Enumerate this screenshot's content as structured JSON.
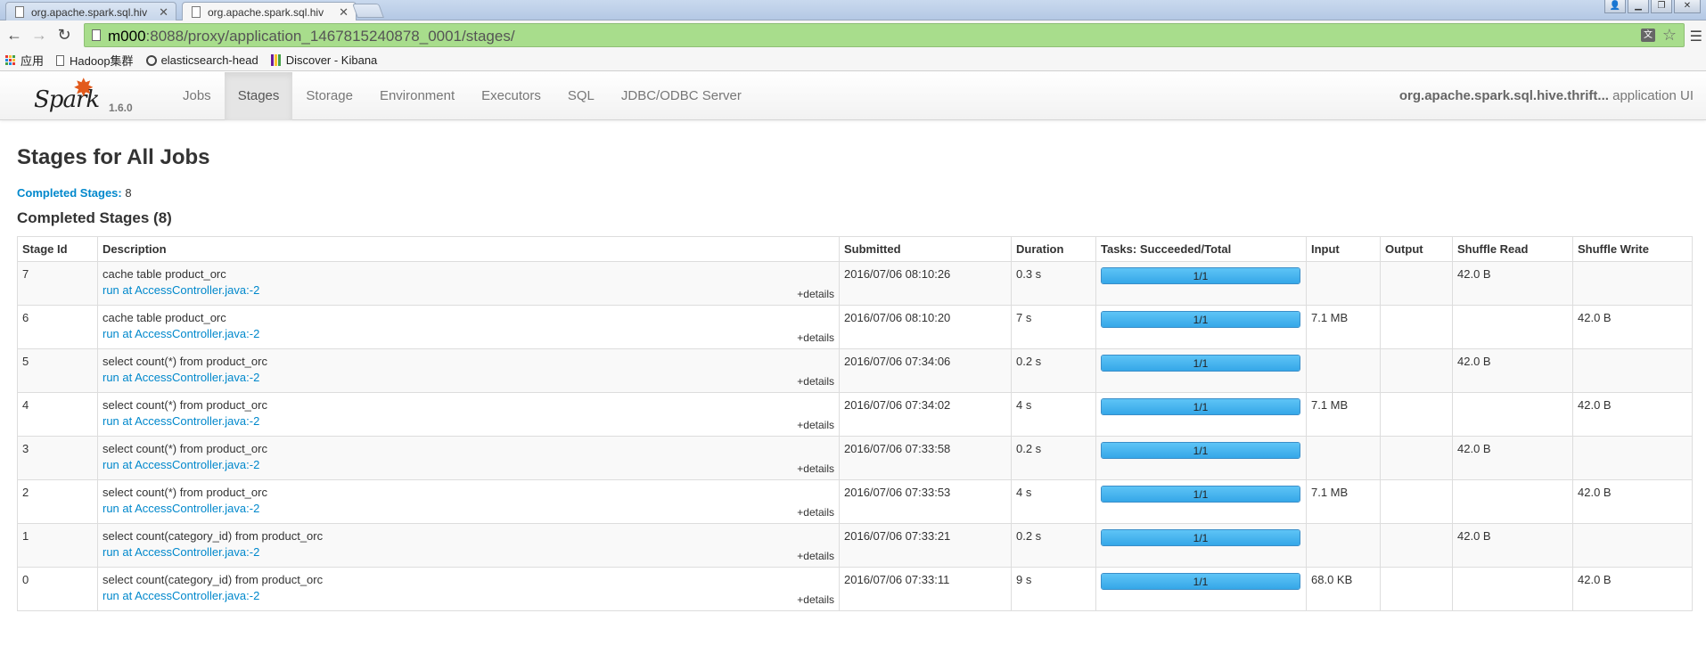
{
  "browser": {
    "tabs": [
      {
        "title": "org.apache.spark.sql.hiv",
        "active": false
      },
      {
        "title": "org.apache.spark.sql.hiv",
        "active": true
      }
    ],
    "url_host": "m000",
    "url_path": ":8088/proxy/application_1467815240878_0001/stages/",
    "bookmarks": [
      {
        "label": "应用",
        "icon": "apps-icon"
      },
      {
        "label": "Hadoop集群",
        "icon": "page-icon"
      },
      {
        "label": "elasticsearch-head",
        "icon": "elasticsearch-icon"
      },
      {
        "label": "Discover - Kibana",
        "icon": "kibana-icon"
      }
    ],
    "omnibox_color": "#a8dd8c"
  },
  "navbar": {
    "brand_word": "Spark",
    "version": "1.6.0",
    "links": [
      {
        "label": "Jobs",
        "active": false
      },
      {
        "label": "Stages",
        "active": true
      },
      {
        "label": "Storage",
        "active": false
      },
      {
        "label": "Environment",
        "active": false
      },
      {
        "label": "Executors",
        "active": false
      },
      {
        "label": "SQL",
        "active": false
      },
      {
        "label": "JDBC/ODBC Server",
        "active": false
      }
    ],
    "app_name": "org.apache.spark.sql.hive.thrift...",
    "app_suffix": " application UI"
  },
  "page": {
    "title": "Stages for All Jobs",
    "summary_label": "Completed Stages:",
    "summary_value": " 8",
    "section_title": "Completed Stages (8)"
  },
  "table": {
    "columns": [
      "Stage Id",
      "Description",
      "Submitted",
      "Duration",
      "Tasks: Succeeded/Total",
      "Input",
      "Output",
      "Shuffle Read",
      "Shuffle Write"
    ],
    "details_label": "+details",
    "rows": [
      {
        "id": "7",
        "desc": "cache table product_orc",
        "link": "run at AccessController.java:-2",
        "submitted": "2016/07/06 08:10:26",
        "duration": "0.3 s",
        "tasks": "1/1",
        "progress": 1.0,
        "input": "",
        "output": "",
        "shuffle_read": "42.0 B",
        "shuffle_write": ""
      },
      {
        "id": "6",
        "desc": "cache table product_orc",
        "link": "run at AccessController.java:-2",
        "submitted": "2016/07/06 08:10:20",
        "duration": "7 s",
        "tasks": "1/1",
        "progress": 1.0,
        "input": "7.1 MB",
        "output": "",
        "shuffle_read": "",
        "shuffle_write": "42.0 B"
      },
      {
        "id": "5",
        "desc": "select count(*) from product_orc",
        "link": "run at AccessController.java:-2",
        "submitted": "2016/07/06 07:34:06",
        "duration": "0.2 s",
        "tasks": "1/1",
        "progress": 1.0,
        "input": "",
        "output": "",
        "shuffle_read": "42.0 B",
        "shuffle_write": ""
      },
      {
        "id": "4",
        "desc": "select count(*) from product_orc",
        "link": "run at AccessController.java:-2",
        "submitted": "2016/07/06 07:34:02",
        "duration": "4 s",
        "tasks": "1/1",
        "progress": 1.0,
        "input": "7.1 MB",
        "output": "",
        "shuffle_read": "",
        "shuffle_write": "42.0 B"
      },
      {
        "id": "3",
        "desc": "select count(*) from product_orc",
        "link": "run at AccessController.java:-2",
        "submitted": "2016/07/06 07:33:58",
        "duration": "0.2 s",
        "tasks": "1/1",
        "progress": 1.0,
        "input": "",
        "output": "",
        "shuffle_read": "42.0 B",
        "shuffle_write": ""
      },
      {
        "id": "2",
        "desc": "select count(*) from product_orc",
        "link": "run at AccessController.java:-2",
        "submitted": "2016/07/06 07:33:53",
        "duration": "4 s",
        "tasks": "1/1",
        "progress": 1.0,
        "input": "7.1 MB",
        "output": "",
        "shuffle_read": "",
        "shuffle_write": "42.0 B"
      },
      {
        "id": "1",
        "desc": "select count(category_id) from product_orc",
        "link": "run at AccessController.java:-2",
        "submitted": "2016/07/06 07:33:21",
        "duration": "0.2 s",
        "tasks": "1/1",
        "progress": 1.0,
        "input": "",
        "output": "",
        "shuffle_read": "42.0 B",
        "shuffle_write": ""
      },
      {
        "id": "0",
        "desc": "select count(category_id) from product_orc",
        "link": "run at AccessController.java:-2",
        "submitted": "2016/07/06 07:33:11",
        "duration": "9 s",
        "tasks": "1/1",
        "progress": 1.0,
        "input": "68.0 KB",
        "output": "",
        "shuffle_read": "",
        "shuffle_write": "42.0 B"
      }
    ]
  },
  "colors": {
    "link": "#0088cc",
    "progress_fill": "#3eb0ef",
    "spark_orange": "#e25a1c"
  }
}
